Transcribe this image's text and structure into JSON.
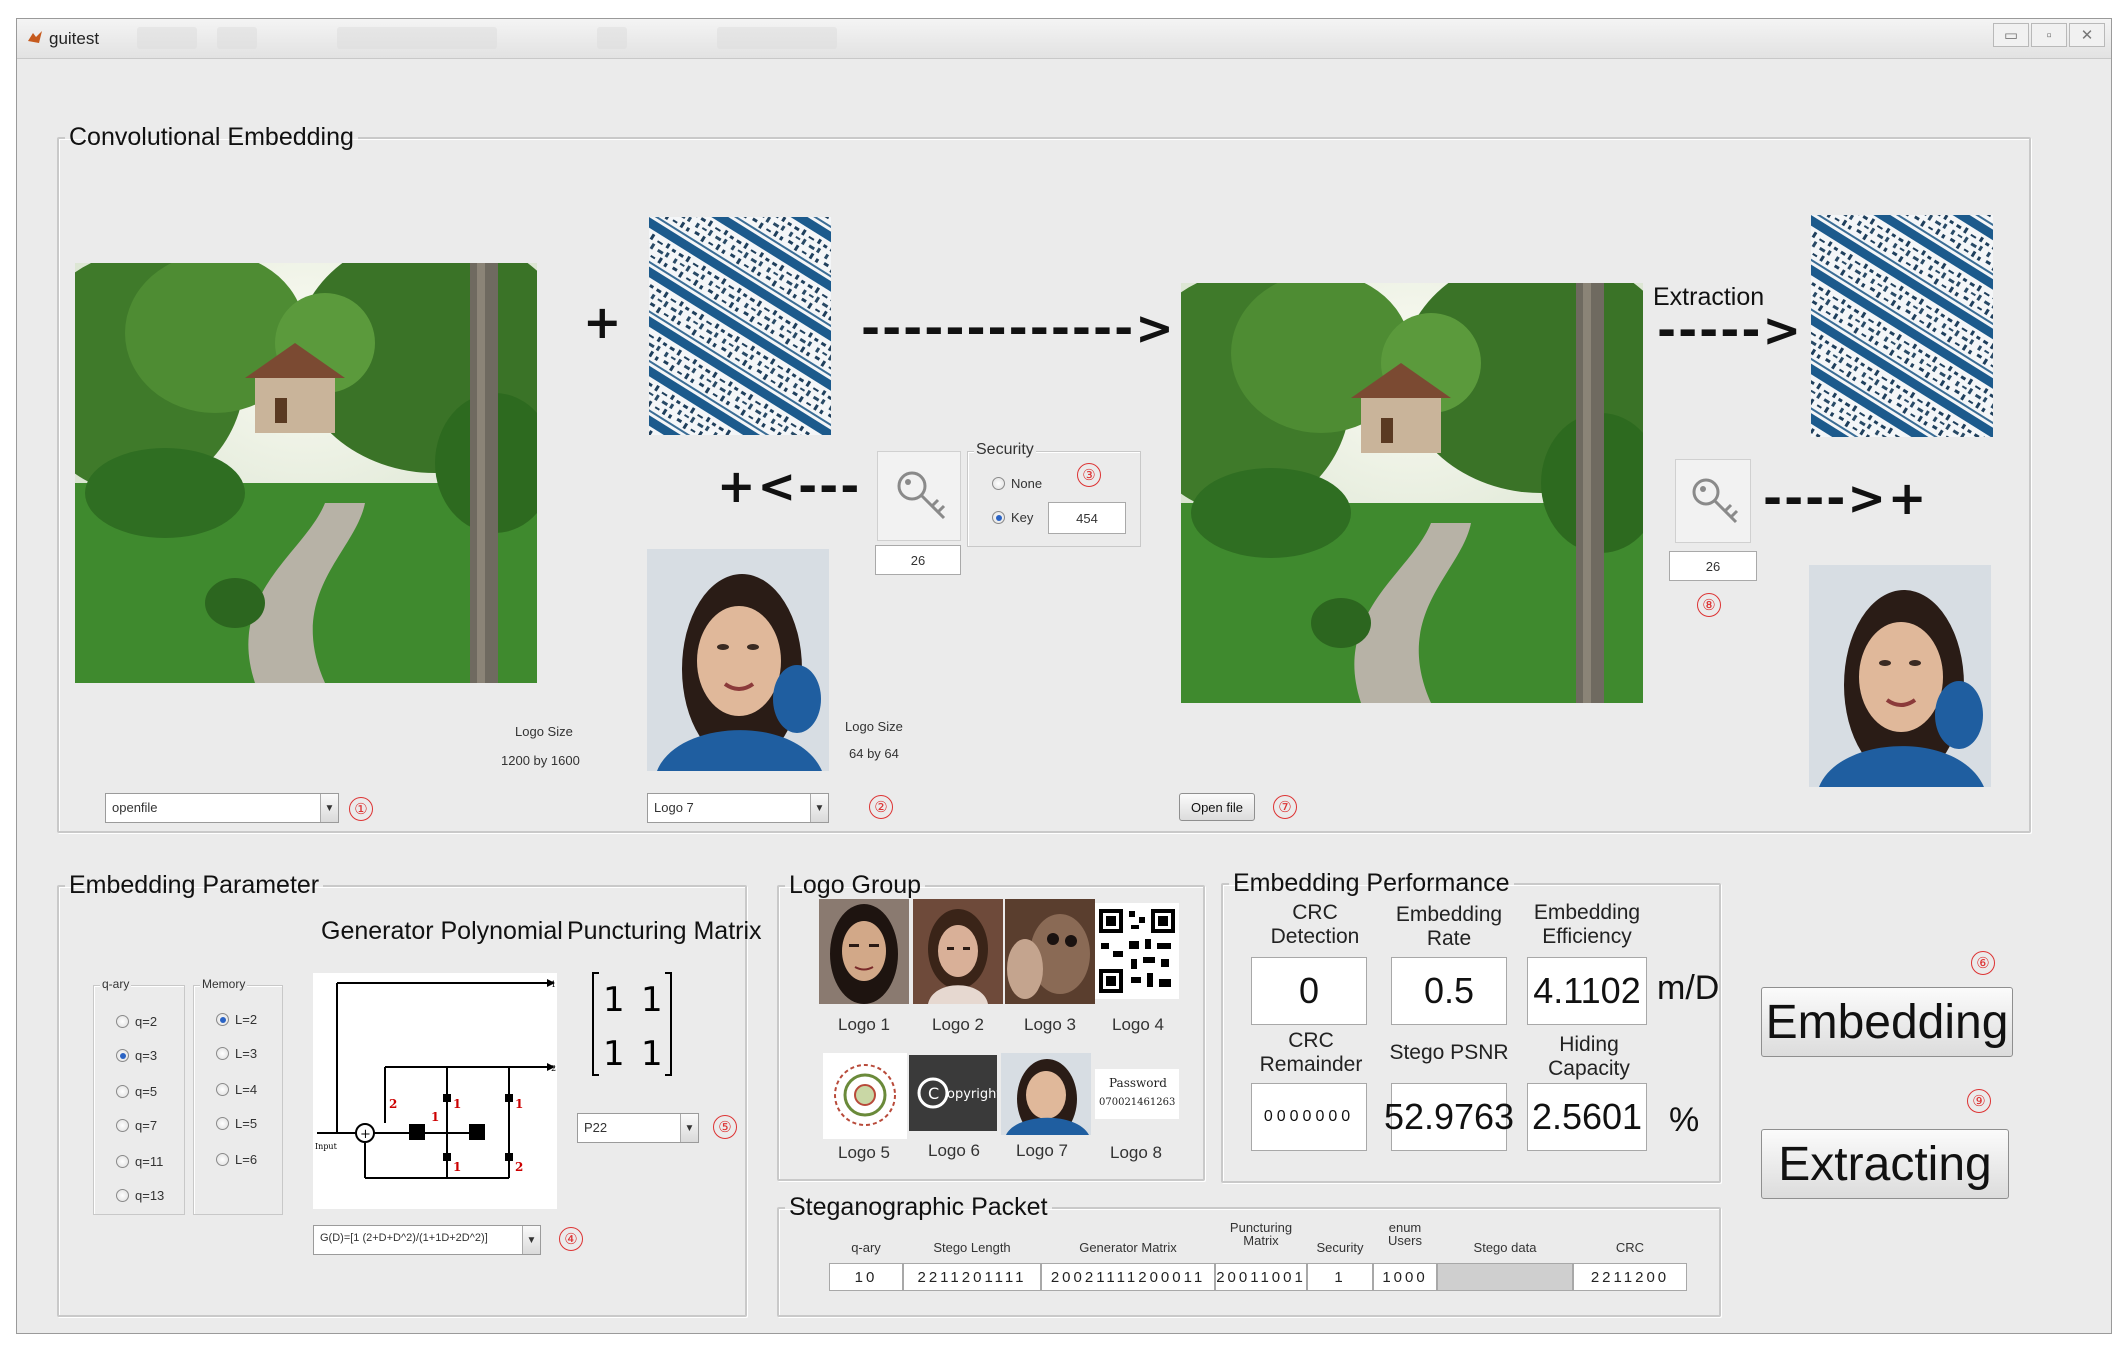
{
  "window": {
    "title": "guitest",
    "controls": {
      "minimize": "▭",
      "maximize": "▫",
      "close": "✕"
    }
  },
  "embedding_panel": {
    "legend": "Convolutional Embedding",
    "plus": "+",
    "arrow_long": "------------->",
    "arrow_back": "+<---",
    "extraction_label": "Extraction",
    "arrow_extract": "----->",
    "arrow_extract_back": "---->+",
    "host_logo_size_label": "Logo Size",
    "host_logo_size_value": "1200 by 1600",
    "logo_size_label": "Logo Size",
    "logo_size_value": "64 by 64",
    "host_select_value": "openfile",
    "logo_select_value": "Logo 7",
    "key_value_left": "26",
    "key_value_right": "26",
    "open_file_button": "Open file",
    "security": {
      "title": "Security",
      "option_none": "None",
      "option_key": "Key",
      "selected": "Key",
      "key_input": "454"
    },
    "markers": [
      "①",
      "②",
      "③",
      "⑦",
      "⑧"
    ]
  },
  "parameter_panel": {
    "legend": "Embedding Parameter",
    "generator_title": "Generator Polynomial",
    "puncturing_title": "Puncturing Matrix",
    "qary": {
      "title": "q-ary",
      "options": [
        "q=2",
        "q=3",
        "q=5",
        "q=7",
        "q=11",
        "q=13"
      ],
      "selected": "q=3"
    },
    "memory": {
      "title": "Memory",
      "options": [
        "L=2",
        "L=3",
        "L=4",
        "L=5",
        "L=6"
      ],
      "selected": "L=2"
    },
    "matrix": [
      "1",
      "1",
      "1",
      "1"
    ],
    "diagram_labels": {
      "input": "Input",
      "out1": "1",
      "out2": "2",
      "c2a": "2",
      "c1a": "1",
      "c1b": "1",
      "c1c": "1",
      "c1d": "1",
      "c2b": "2"
    },
    "puncture_select": "P22",
    "generator_select": "G(D)=[1 (2+D+D^2)/(1+1D+2D^2)]",
    "markers": [
      "⑤",
      "④"
    ]
  },
  "logo_group": {
    "legend": "Logo Group",
    "logos": [
      "Logo 1",
      "Logo 2",
      "Logo 3",
      "Logo 4",
      "Logo 5",
      "Logo 6",
      "Logo 7",
      "Logo 8"
    ],
    "logo6_text": "opyright",
    "logo8_text": "Password\n070021461263"
  },
  "performance_panel": {
    "legend": "Embedding Performance",
    "crc_detection_label": "CRC\nDetection",
    "crc_detection_value": "0",
    "embedding_rate_label": "Embedding\nRate",
    "embedding_rate_value": "0.5",
    "embedding_efficiency_label": "Embedding\nEfficiency",
    "embedding_efficiency_value": "4.1102",
    "efficiency_unit": "m/D",
    "crc_remainder_label": "CRC\nRemainder",
    "crc_remainder_value": "0000000",
    "stego_psnr_label": "Stego PSNR",
    "stego_psnr_value": "52.9763",
    "hiding_capacity_label": "Hiding\nCapacity",
    "hiding_capacity_value": "2.5601",
    "capacity_unit": "%"
  },
  "actions": {
    "embed_button": "Embedding",
    "extract_button": "Extracting",
    "markers": [
      "⑥",
      "⑨"
    ]
  },
  "packet_panel": {
    "legend": "Steganographic Packet",
    "fields": [
      {
        "label": "q-ary",
        "value": "10"
      },
      {
        "label": "Stego Length",
        "value": "2211201111"
      },
      {
        "label": "Generator Matrix",
        "value": "20021111200011"
      },
      {
        "label": "Puncturing\nMatrix",
        "value": "20011001"
      },
      {
        "label": "Security",
        "value": "1"
      },
      {
        "label": "enum\nUsers",
        "value": "1000"
      },
      {
        "label": "Stego data",
        "value": ""
      },
      {
        "label": "CRC",
        "value": "2211200"
      }
    ]
  },
  "colors": {
    "window_bg": "#ebebeb",
    "marker_red": "#d33333",
    "radio_blue": "#2a63c4",
    "pattern_blue": "#1c5a8c"
  }
}
